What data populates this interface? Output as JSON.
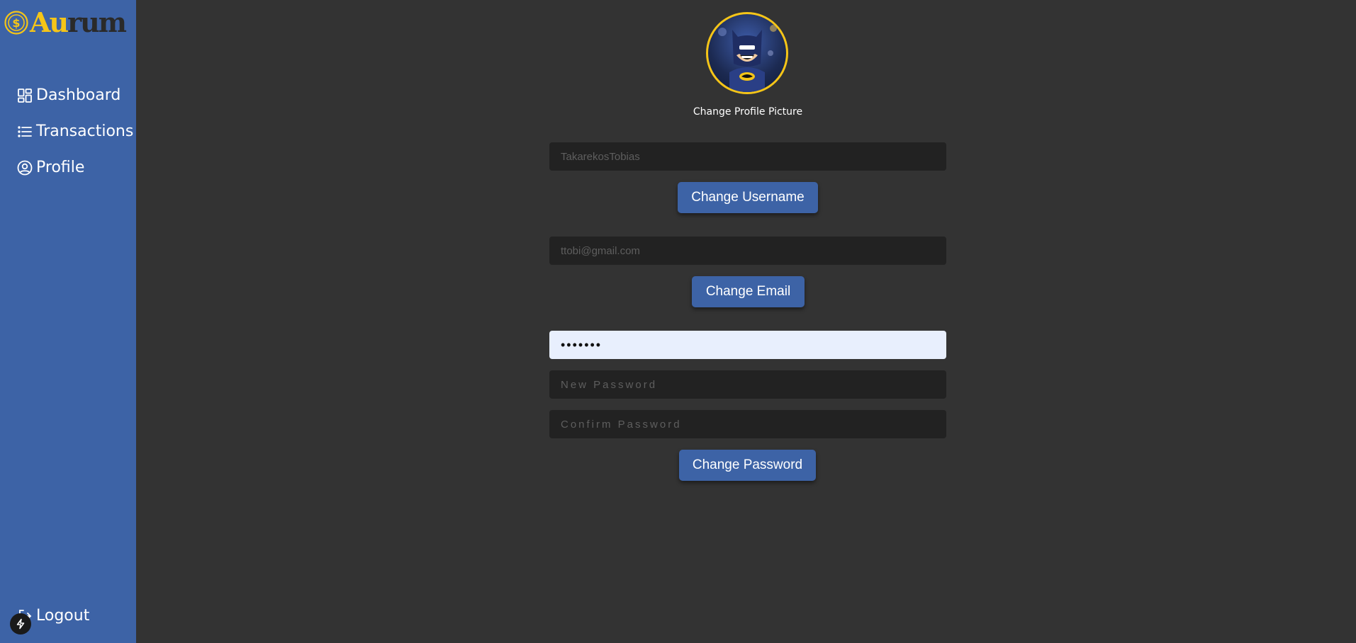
{
  "brand": {
    "name_part1": "Au",
    "name_part2": "rum",
    "icon": "dollar-coin-icon",
    "colors": {
      "gold": "#f5c518",
      "dark": "#2a2a2a"
    }
  },
  "sidebar": {
    "background": "#3d63a6",
    "items": [
      {
        "label": "Dashboard",
        "icon": "dashboard-grid-icon"
      },
      {
        "label": "Transactions",
        "icon": "list-icon"
      },
      {
        "label": "Profile",
        "icon": "user-circle-icon"
      }
    ],
    "logout": {
      "label": "Logout",
      "icon": "logout-icon"
    }
  },
  "profile": {
    "avatar_icon": "batman-avatar",
    "change_picture_label": "Change Profile Picture",
    "username": {
      "value": "",
      "placeholder": "TakarekosTobias",
      "button": "Change Username"
    },
    "email": {
      "value": "",
      "placeholder": "ttobi@gmail.com",
      "button": "Change Email"
    },
    "password": {
      "current_value": "•••••••",
      "new_placeholder": "New Password",
      "confirm_placeholder": "Confirm Password",
      "button": "Change Password"
    }
  },
  "colors": {
    "page_bg": "#333333",
    "input_bg": "#222222",
    "input_active_bg": "#e8effd",
    "accent": "#3d63a6"
  },
  "devtools_badge": {
    "icon": "lightning-icon"
  }
}
